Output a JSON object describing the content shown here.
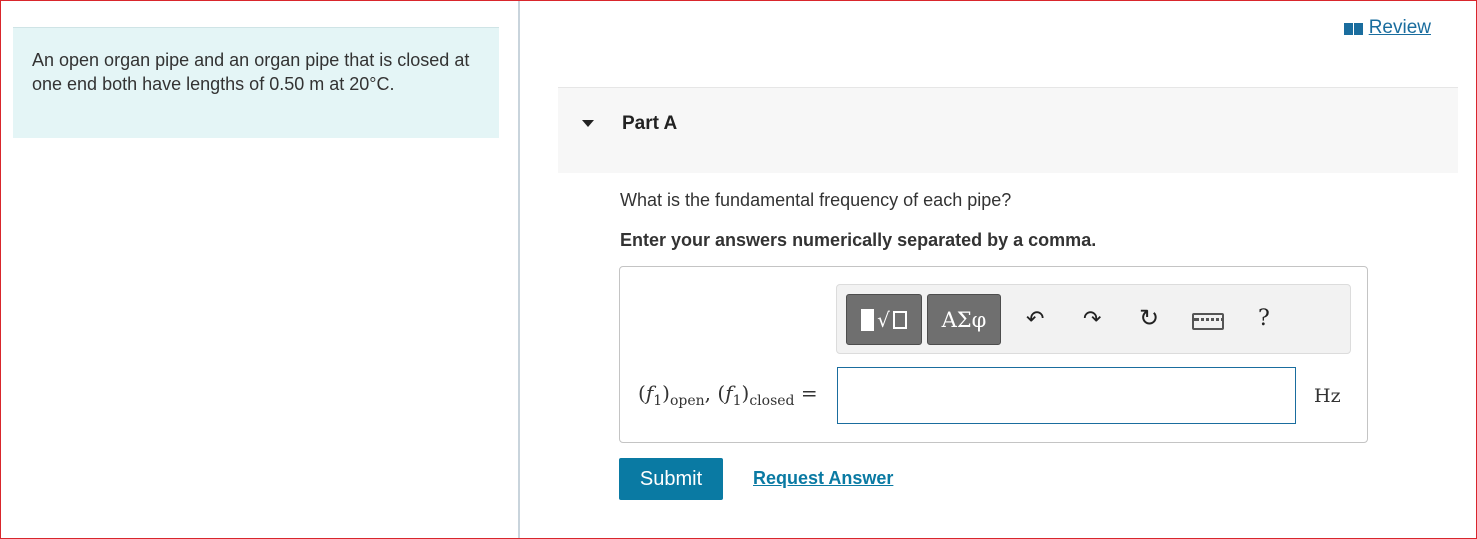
{
  "problem": {
    "text": "An open organ pipe and an organ pipe that is closed at one end both have lengths of 0.50 m at 20°C."
  },
  "review": {
    "label": "Review",
    "icon": "book-icon"
  },
  "part": {
    "title": "Part A",
    "expanded": true
  },
  "question": "What is the fundamental frequency of each pipe?",
  "instruction": "Enter your answers numerically separated by a comma.",
  "toolbar": {
    "greek_label": "ΑΣφ",
    "help_label": "?",
    "icons": [
      "templates-icon",
      "greek-letters-icon",
      "undo-icon",
      "redo-icon",
      "reset-icon",
      "keyboard-icon",
      "help-icon"
    ]
  },
  "answer": {
    "label_f1": "f",
    "label_sub1": "1",
    "label_open": "open",
    "label_sep": ", ",
    "label_closed": "closed",
    "label_eq": "=",
    "value": "",
    "unit": "Hz"
  },
  "actions": {
    "submit": "Submit",
    "request_answer": "Request Answer"
  },
  "colors": {
    "accent": "#0a7aa3",
    "frame_border": "#d9262c",
    "problem_bg": "#e4f5f6"
  }
}
